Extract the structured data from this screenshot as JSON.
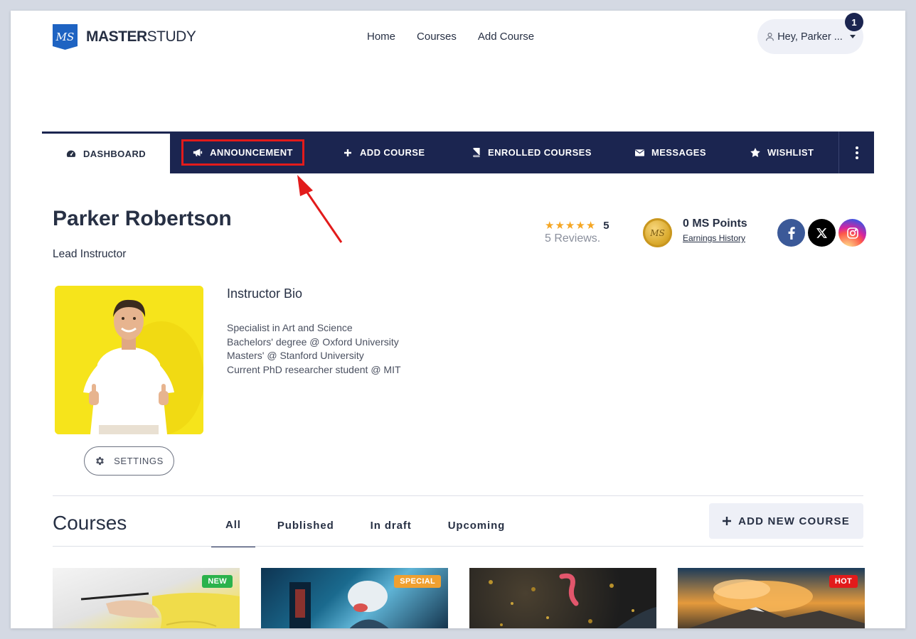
{
  "header": {
    "logo_mark": "MS",
    "logo_bold": "MASTER",
    "logo_light": "STUDY",
    "nav": [
      "Home",
      "Courses",
      "Add Course"
    ],
    "user_greeting": "Hey, Parker ...",
    "notification_count": "1"
  },
  "dashboard_nav": {
    "items": [
      {
        "label": "DASHBOARD",
        "icon": "gauge-icon",
        "active": true
      },
      {
        "label": "ANNOUNCEMENT",
        "icon": "megaphone-icon",
        "highlighted": true
      },
      {
        "label": "ADD COURSE",
        "icon": "plus-icon"
      },
      {
        "label": "ENROLLED COURSES",
        "icon": "book-icon"
      },
      {
        "label": "MESSAGES",
        "icon": "envelope-icon"
      },
      {
        "label": "WISHLIST",
        "icon": "star-icon"
      }
    ],
    "more_icon": "vertical-dots-icon"
  },
  "profile": {
    "name": "Parker Robertson",
    "role": "Lead Instructor",
    "rating_value": "5",
    "rating_stars": 5,
    "reviews": "5 Reviews.",
    "points": "0 MS Points",
    "earnings_link": "Earnings History",
    "coin_mark": "MS",
    "socials": [
      "facebook-icon",
      "x-icon",
      "instagram-icon"
    ],
    "settings_label": "SETTINGS",
    "bio_title": "Instructor Bio",
    "bio_lines": [
      "Specialist in Art and Science",
      "Bachelors' degree @ Oxford University",
      "Masters' @ Stanford University",
      "Current PhD researcher student @ MIT"
    ]
  },
  "courses": {
    "title": "Courses",
    "tabs": [
      "All",
      "Published",
      "In draft",
      "Upcoming"
    ],
    "active_tab": "All",
    "add_new_label": "ADD NEW COURSE",
    "cards": [
      {
        "badge": "NEW",
        "badge_color": "#2bb24c"
      },
      {
        "badge": "SPECIAL",
        "badge_color": "#f0a030"
      },
      {
        "badge": "",
        "badge_color": ""
      },
      {
        "badge": "HOT",
        "badge_color": "#e21b1b"
      }
    ]
  },
  "colors": {
    "nav_bg": "#1b2550",
    "highlight": "#e21b1b",
    "accent_star": "#f5a623"
  }
}
